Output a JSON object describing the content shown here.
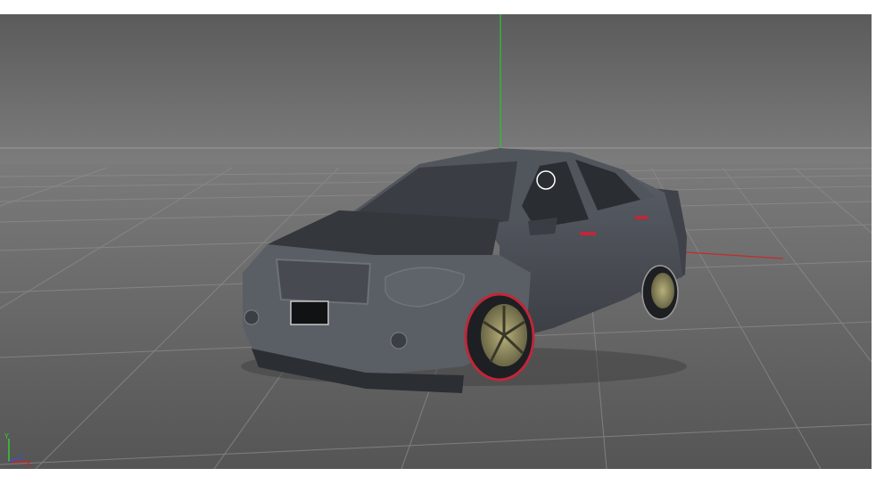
{
  "viewport": {
    "view": "perspective",
    "colors": {
      "sky_top": "#5e5e5e",
      "sky_bottom": "#7c7c7c",
      "floor_near": "#5a5a5a",
      "floor_far": "#7a7a7a",
      "grid_line": "#8a8a8a",
      "y_axis": "#33cc33",
      "x_axis": "#cc2222",
      "car_body": "#4c5057",
      "car_dark": "#2b2e33",
      "tire_accent": "#c0273a",
      "rim": "#8c8a62"
    }
  },
  "axis_gizmo": {
    "y_label": "Y",
    "z_label": "Z",
    "x_label": "X"
  }
}
